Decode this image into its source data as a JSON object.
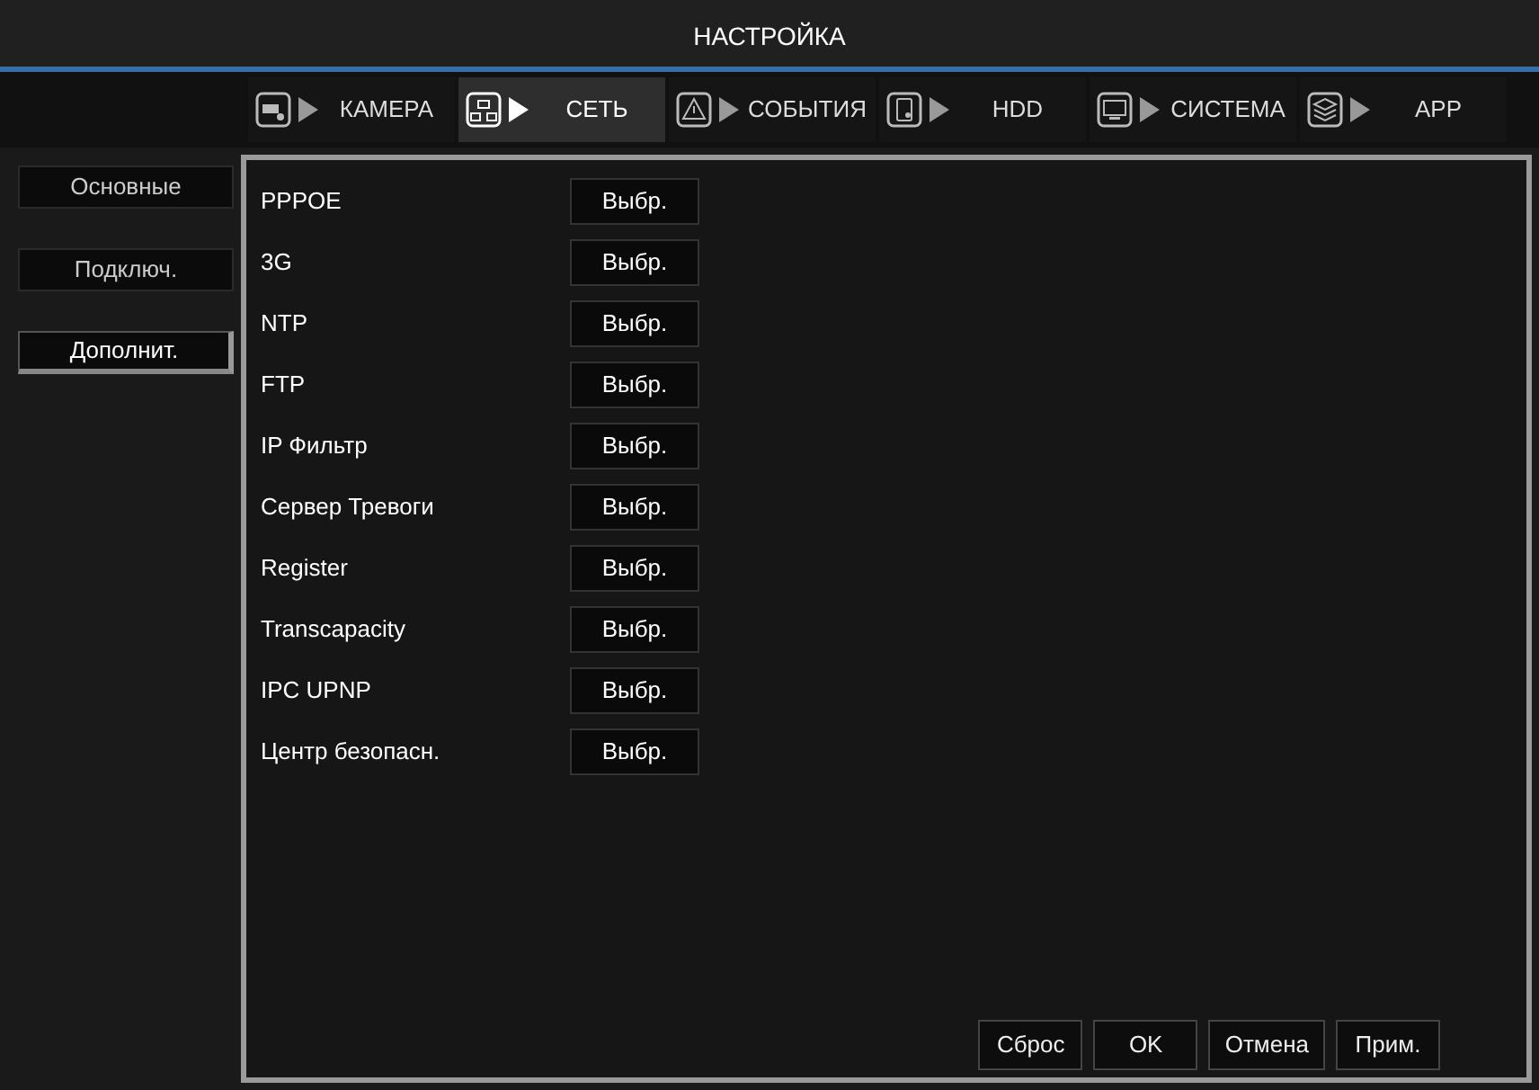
{
  "window": {
    "title": "НАСТРОЙКА"
  },
  "tabs": [
    {
      "label": "КАМЕРА",
      "kind": "camera",
      "selected": false
    },
    {
      "label": "СЕТЬ",
      "kind": "network",
      "selected": true
    },
    {
      "label": "СОБЫТИЯ",
      "kind": "alarm",
      "selected": false
    },
    {
      "label": "HDD",
      "kind": "disk",
      "selected": false
    },
    {
      "label": "СИСТЕМА",
      "kind": "monitor",
      "selected": false
    },
    {
      "label": "APP",
      "kind": "box",
      "selected": false
    }
  ],
  "sidebar": {
    "items": [
      {
        "label": "Основные",
        "selected": false
      },
      {
        "label": "Подключ.",
        "selected": false
      },
      {
        "label": "Дополнит.",
        "selected": true
      }
    ]
  },
  "settings": [
    {
      "label": "PPPOE",
      "button": "Выбр."
    },
    {
      "label": "3G",
      "button": "Выбр."
    },
    {
      "label": "NTP",
      "button": "Выбр."
    },
    {
      "label": "FTP",
      "button": "Выбр."
    },
    {
      "label": "IP Фильтр",
      "button": "Выбр."
    },
    {
      "label": "Сервер Тревоги",
      "button": "Выбр."
    },
    {
      "label": "Register",
      "button": "Выбр."
    },
    {
      "label": "Transcapacity",
      "button": "Выбр."
    },
    {
      "label": "IPC UPNP",
      "button": "Выбр."
    },
    {
      "label": "Центр безопасн.",
      "button": "Выбр."
    }
  ],
  "buttons": [
    "Сброс",
    "OK",
    "Отмена",
    "Прим."
  ]
}
